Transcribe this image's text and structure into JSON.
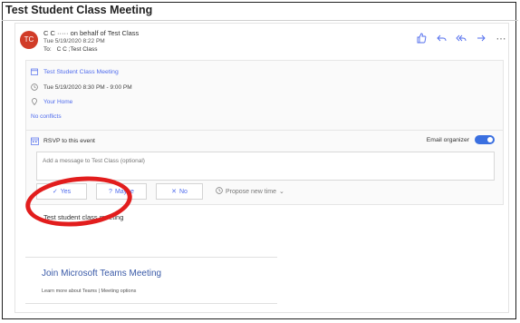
{
  "subject": "Test Student Class Meeting",
  "message": {
    "avatar_initials": "TC",
    "sender": "C  C  ·····  on behalf of Test Class",
    "sent": "Tue 5/19/2020 8:22 PM",
    "to_label": "To:",
    "to_recipients": "C    C   ;Test Class"
  },
  "toolbar": {
    "like_icon": "thumbs-up-icon",
    "reply_icon": "reply-icon",
    "reply_all_icon": "reply-all-icon",
    "forward_icon": "forward-icon",
    "more_icon": "more-icon"
  },
  "event": {
    "title": "Test Student Class Meeting",
    "time": "Tue 5/19/2020 8:30 PM - 9:00 PM",
    "location": "Your Home",
    "conflicts": "No conflicts"
  },
  "rsvp": {
    "label": "RSVP to this event",
    "email_organizer": "Email organizer",
    "email_organizer_on": true,
    "message_placeholder": "Add a message to Test Class (optional)",
    "buttons": {
      "yes": "Yes",
      "maybe": "Maybe",
      "no": "No",
      "propose": "Propose new time"
    }
  },
  "body": {
    "text": "Test student class meeting",
    "join": "Join Microsoft Teams Meeting",
    "learn_more": "Learn more about Teams",
    "separator": "|",
    "options": "Meeting options"
  },
  "colors": {
    "accent": "#4f6bed",
    "avatar": "#d13c28",
    "annotation": "#e21d1d"
  }
}
